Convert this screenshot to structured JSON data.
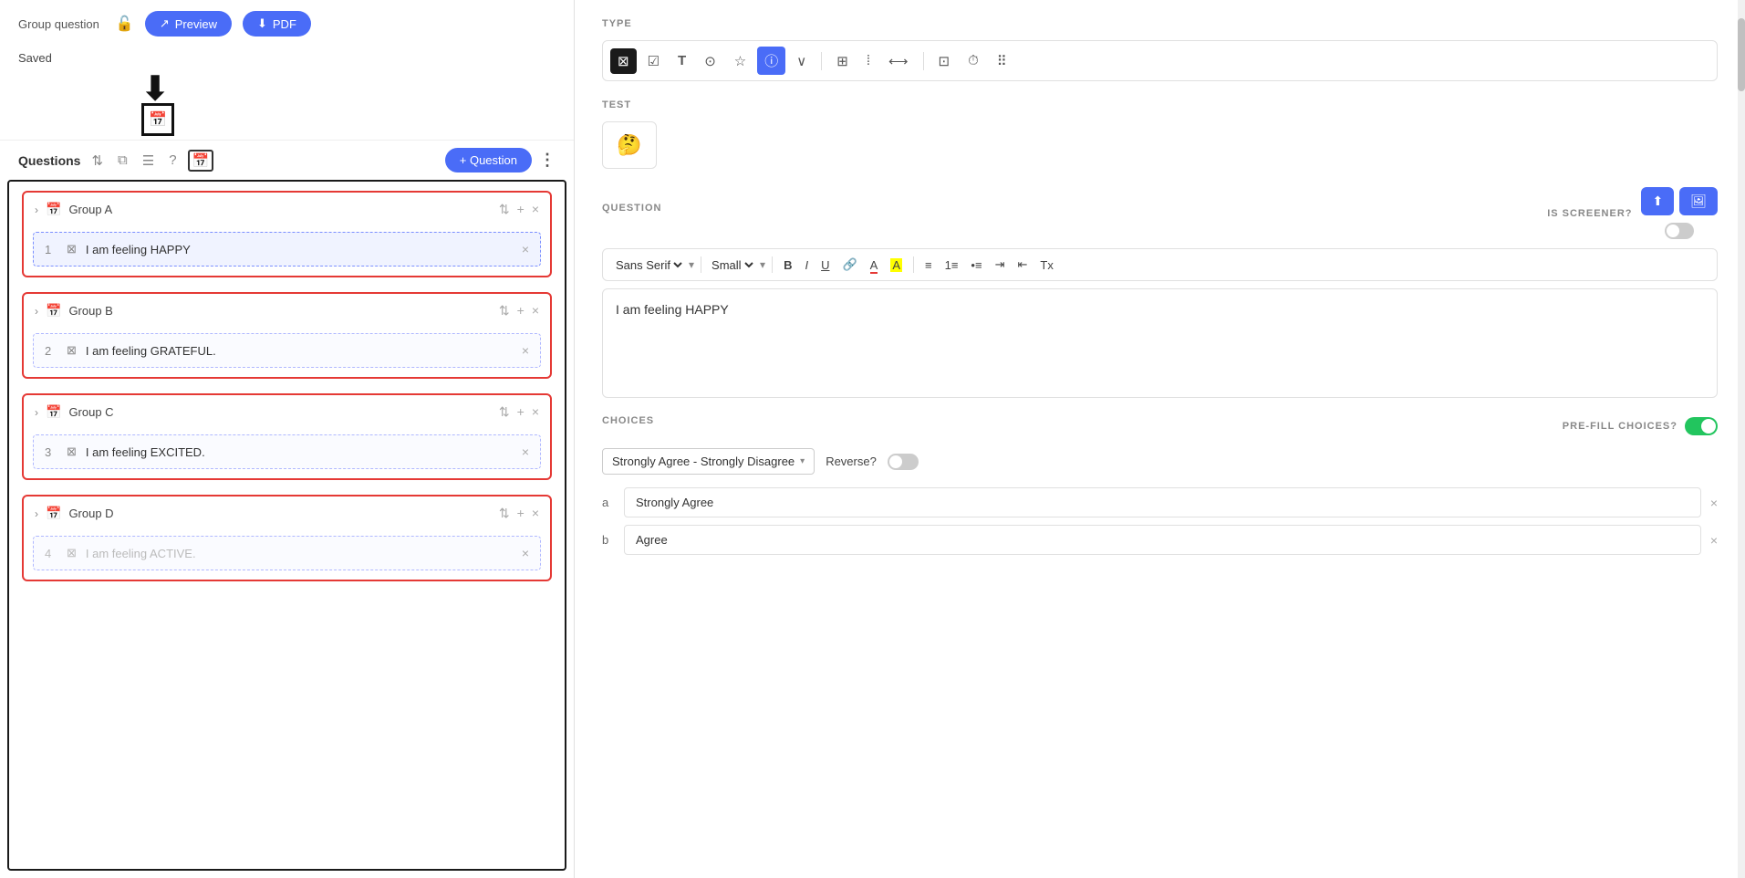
{
  "header": {
    "group_question_label": "Group question",
    "preview_btn": "Preview",
    "pdf_btn": "PDF",
    "saved_label": "Saved"
  },
  "questions_bar": {
    "title": "Questions",
    "add_question_btn": "+ Question"
  },
  "groups": [
    {
      "id": "group-a",
      "name": "Group A",
      "questions": [
        {
          "num": "1",
          "text": "I am feeling HAPPY",
          "active": true
        }
      ]
    },
    {
      "id": "group-b",
      "name": "Group B",
      "questions": [
        {
          "num": "2",
          "text": "I am feeling GRATEFUL.",
          "active": false
        }
      ]
    },
    {
      "id": "group-c",
      "name": "Group C",
      "questions": [
        {
          "num": "3",
          "text": "I am feeling EXCITED.",
          "active": false
        }
      ]
    },
    {
      "id": "group-d",
      "name": "Group D",
      "questions": [
        {
          "num": "4",
          "text": "I am feeling ACTIVE.",
          "active": false
        }
      ]
    }
  ],
  "right_panel": {
    "type_label": "TYPE",
    "test_label": "TEST",
    "question_label": "QUESTION",
    "is_screener_label": "IS SCREENER?",
    "choices_label": "CHOICES",
    "pre_fill_label": "PRE-FILL CHOICES?",
    "font_family": "Sans Serif",
    "font_size": "Small",
    "question_text": "I am feeling HAPPY",
    "choices_dropdown_value": "Strongly Agree - Strongly Disagree",
    "reverse_label": "Reverse?",
    "choices": [
      {
        "letter": "a",
        "value": "Strongly Agree"
      },
      {
        "letter": "b",
        "value": "Agree"
      }
    ],
    "type_icons": [
      {
        "name": "matrix-x-icon",
        "symbol": "⊠",
        "active": true
      },
      {
        "name": "checkbox-icon",
        "symbol": "☑",
        "active": false
      },
      {
        "name": "text-icon",
        "symbol": "T",
        "active": false
      },
      {
        "name": "camera-icon",
        "symbol": "⊙",
        "active": false
      },
      {
        "name": "star-icon",
        "symbol": "★",
        "active": false
      },
      {
        "name": "info-icon",
        "symbol": "ⓘ",
        "active": false
      },
      {
        "name": "dropdown-icon",
        "symbol": "⌄",
        "active": false
      },
      {
        "name": "grid-icon",
        "symbol": "⊞",
        "active": false
      },
      {
        "name": "scale-icon",
        "symbol": "⁝",
        "active": false
      },
      {
        "name": "arrow-icon",
        "symbol": "⟷",
        "active": false
      },
      {
        "name": "image-grid-icon",
        "symbol": "⊡",
        "active": false
      },
      {
        "name": "clock-icon",
        "symbol": "⏱",
        "active": false
      },
      {
        "name": "dots-icon",
        "symbol": "⠿",
        "active": false
      }
    ]
  }
}
